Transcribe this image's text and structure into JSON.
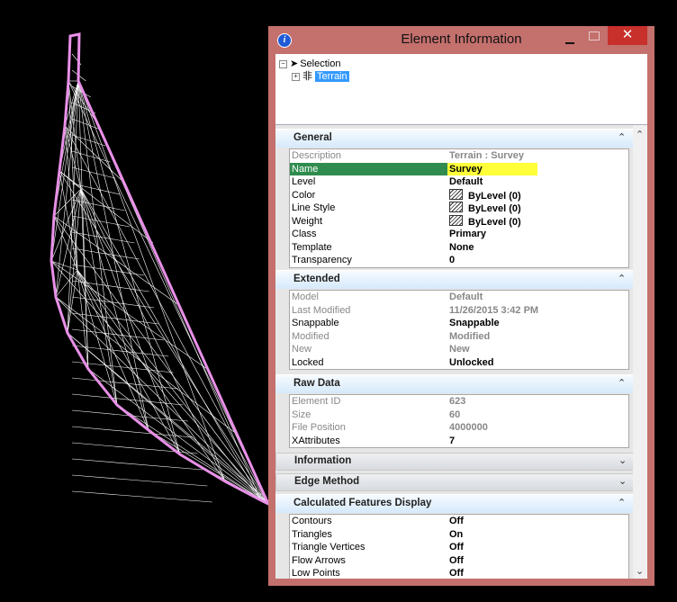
{
  "window": {
    "title": "Element Information",
    "close_glyph": "✕"
  },
  "tree": {
    "selection_label": "Selection",
    "child_label": "Terrain"
  },
  "sections": {
    "general": {
      "title": "General",
      "rows": [
        {
          "key": "Description",
          "value": "Terrain : Survey"
        },
        {
          "key": "Name",
          "value": "Survey"
        },
        {
          "key": "Level",
          "value": "Default"
        },
        {
          "key": "Color",
          "value": "ByLevel (0)"
        },
        {
          "key": "Line Style",
          "value": "ByLevel (0)"
        },
        {
          "key": "Weight",
          "value": "ByLevel (0)"
        },
        {
          "key": "Class",
          "value": "Primary"
        },
        {
          "key": "Template",
          "value": "None"
        },
        {
          "key": "Transparency",
          "value": "0"
        }
      ]
    },
    "extended": {
      "title": "Extended",
      "rows": [
        {
          "key": "Model",
          "value": "Default"
        },
        {
          "key": "Last Modified",
          "value": "11/26/2015 3:42 PM"
        },
        {
          "key": "Snappable",
          "value": "Snappable"
        },
        {
          "key": "Modified",
          "value": "Modified"
        },
        {
          "key": "New",
          "value": "New"
        },
        {
          "key": "Locked",
          "value": "Unlocked"
        }
      ]
    },
    "raw_data": {
      "title": "Raw Data",
      "rows": [
        {
          "key": "Element ID",
          "value": "623"
        },
        {
          "key": "Size",
          "value": "60"
        },
        {
          "key": "File Position",
          "value": "4000000"
        },
        {
          "key": "XAttributes",
          "value": "7"
        }
      ]
    },
    "information": {
      "title": "Information"
    },
    "edge_method": {
      "title": "Edge Method"
    },
    "calculated": {
      "title": "Calculated Features Display",
      "rows": [
        {
          "key": "Contours",
          "value": "Off"
        },
        {
          "key": "Triangles",
          "value": "On"
        },
        {
          "key": "Triangle Vertices",
          "value": "Off"
        },
        {
          "key": "Flow Arrows",
          "value": "Off"
        },
        {
          "key": "Low Points",
          "value": "Off"
        }
      ]
    }
  },
  "colors": {
    "titlebar": "#c4706d",
    "selection_highlight": "#2f8c4e",
    "value_highlight": "#ffff3a",
    "terrain_outline": "#e890e8"
  }
}
